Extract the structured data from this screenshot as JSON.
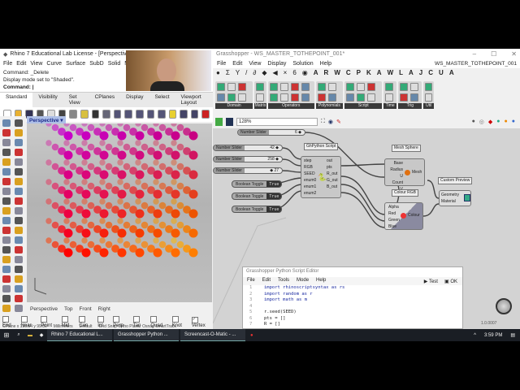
{
  "rhino": {
    "title": "Rhino 7 Educational Lab License - [Perspective]",
    "menu": [
      "File",
      "Edit",
      "View",
      "Curve",
      "Surface",
      "SubD",
      "Solid",
      "Mesh",
      "Di"
    ],
    "command_history": [
      "Command: _Delete",
      "Display mode set to \"Shaded\"."
    ],
    "command_prompt": "Command:",
    "toolbar_tabs": [
      "Standard",
      "Visibility",
      "Set View",
      "CPlanes",
      "Display",
      "Select",
      "Viewport Layout"
    ],
    "viewport_name": "Perspective",
    "viewport_tabs": [
      "Perspective",
      "Top",
      "Front",
      "Right"
    ],
    "osnaps": [
      {
        "label": "End",
        "checked": false
      },
      {
        "label": "Near",
        "checked": false
      },
      {
        "label": "Point",
        "checked": false
      },
      {
        "label": "Mid",
        "checked": false
      },
      {
        "label": "Cen",
        "checked": false
      },
      {
        "label": "Int",
        "checked": false
      },
      {
        "label": "Perp",
        "checked": false
      },
      {
        "label": "Tan",
        "checked": false
      },
      {
        "label": "Quad",
        "checked": false
      },
      {
        "label": "Knot",
        "checked": false
      },
      {
        "label": "Vertex",
        "checked": true
      }
    ],
    "status": [
      "CPlane x 150.54  y 99.80",
      "Millimeters",
      "Default",
      "Grid Snap  Ortho  Planar  Osnap  SmartTrack"
    ]
  },
  "grasshopper": {
    "title": "Grasshopper - WS_MASTER_TOTHEPOINT_001*",
    "document_name": "WS_MASTER_TOTHEPOINT_001",
    "menu": [
      "File",
      "Edit",
      "View",
      "Display",
      "Solution",
      "Help"
    ],
    "category_tabs": [
      "A",
      "R",
      "W",
      "C",
      "P",
      "K",
      "A",
      "W",
      "L",
      "A",
      "J",
      "C",
      "U",
      "A"
    ],
    "panels": [
      "Domain",
      "Matrix",
      "Operators",
      "Polynomials",
      "Script",
      "Time",
      "Trig",
      "Util"
    ],
    "zoom": "128%",
    "version": "1.0.0007",
    "components": {
      "sliders": [
        {
          "label": "Number Slider",
          "value": "6 ◆"
        },
        {
          "label": "Number Slider",
          "value": "42 ◆"
        },
        {
          "label": "Number Slider",
          "value": "258 ◆"
        },
        {
          "label": "Number Slider",
          "value": "◆ 27"
        }
      ],
      "toggles": [
        {
          "label": "Boolean Toggle",
          "value": "True"
        },
        {
          "label": "Boolean Toggle",
          "value": "True"
        },
        {
          "label": "Boolean Toggle",
          "value": "True"
        }
      ],
      "python": {
        "title": "GhPython Script",
        "inputs": [
          "step",
          "RGB",
          "SEED",
          "enum0",
          "enum1",
          "enum2"
        ],
        "outputs": [
          "out",
          "pts",
          "R_out",
          "G_out",
          "B_out"
        ]
      },
      "mesh_sphere": {
        "title": "Mesh Sphere",
        "inputs": [
          "Base",
          "Radius",
          "U Count",
          "V Count"
        ],
        "output": "Mesh"
      },
      "colour_rgb": {
        "title": "Colour RGB",
        "inputs": [
          "Alpha",
          "Red",
          "Green",
          "Blue"
        ],
        "output": "Colour"
      },
      "custom_preview": {
        "title": "Custom Preview",
        "inputs": [
          "Geometry",
          "Material"
        ]
      }
    }
  },
  "python_editor": {
    "title": "Grasshopper Python Script Editor",
    "menu": [
      "File",
      "Edit",
      "Tools",
      "Mode",
      "Help"
    ],
    "test_label": "Test",
    "ok_label": "OK",
    "lines": [
      "import rhinoscriptsyntax as rs",
      "import random as r",
      "import math as m",
      "",
      "r.seed(SEED)",
      "pts = []",
      "R = []"
    ]
  },
  "taskbar": {
    "items": [
      "Rhino 7 Educational L...",
      "Grasshopper Python ...",
      "Screencast-O-Matic - ..."
    ],
    "time": "3:59 PM"
  }
}
